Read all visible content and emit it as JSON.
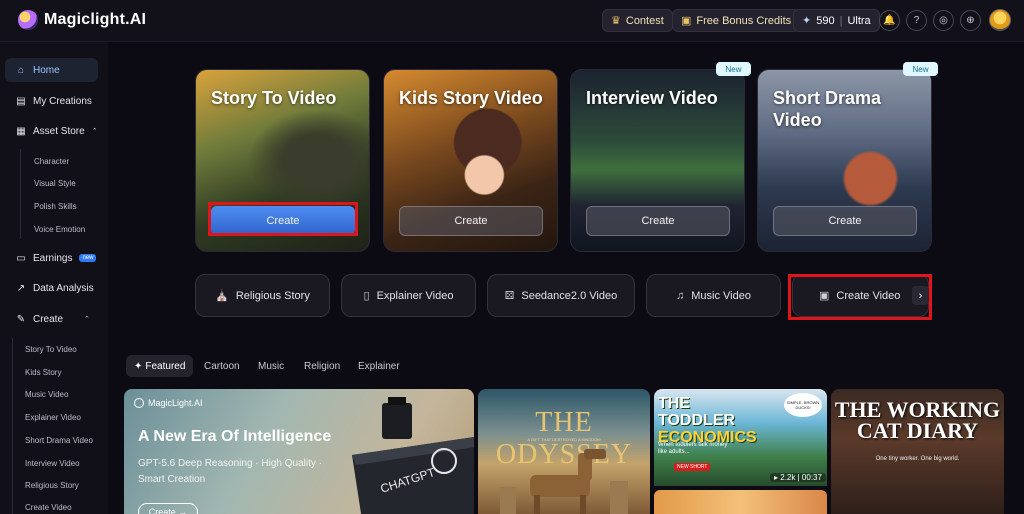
{
  "app": {
    "name": "Magiclight.AI"
  },
  "topbar": {
    "contest": "Contest",
    "bonus": "Free Bonus Credits",
    "credits": "590",
    "plan": "Ultra",
    "separator": "|"
  },
  "sidebar": {
    "home": "Home",
    "my_creations": "My Creations",
    "asset_store": "Asset Store",
    "asset_sub": [
      "Character",
      "Visual Style",
      "Polish Skills",
      "Voice Emotion"
    ],
    "earnings": "Earnings",
    "earnings_badge": "new",
    "data_analysis": "Data Analysis",
    "create": "Create",
    "create_sub": [
      "Story To Video",
      "Kids Story",
      "Music Video",
      "Explainer Video",
      "Short Drama Video",
      "Interview Video",
      "Religious Story",
      "Create Video"
    ]
  },
  "cards": [
    {
      "title": "Story To Video",
      "button": "Create"
    },
    {
      "title": "Kids Story Video",
      "button": "Create"
    },
    {
      "title": "Interview Video",
      "button": "Create",
      "badge": "New"
    },
    {
      "title": "Short Drama Video",
      "button": "Create",
      "badge": "New"
    }
  ],
  "types": [
    "Religious Story",
    "Explainer Video",
    "Seedance2.0 Video",
    "Music Video",
    "Create Video"
  ],
  "categories": [
    "Featured",
    "Cartoon",
    "Music",
    "Religion",
    "Explainer"
  ],
  "featured": {
    "banner": {
      "brand": "MagicLight.AI",
      "title": "A New Era Of Intelligence",
      "subtitle": "GPT-5.6 Deep Reasoning · High Quality · Smart Creation",
      "cta": "Create →",
      "ship_label": "CHATGPT"
    },
    "odyssey": {
      "title": "THE ODYSSEY",
      "subtitle": "A GIFT THAT DESTROYED A KINGDOM"
    },
    "toddler": {
      "title_line1": "TODDLER",
      "title_line2": "ECONOMICS",
      "prefix": "THE",
      "note": "When toddlers talk money like adults...",
      "tag": "NEW SHORT",
      "bubble": "SIMPLE, BROWN DUCKS!",
      "views": "2.2k",
      "duration": "00:37"
    },
    "working_cat": {
      "title": "THE WORKING CAT DIARY",
      "subtitle": "One tiny worker. One big world."
    }
  },
  "colors": {
    "accent": "#2e62c9",
    "highlight": "#e0141b",
    "background": "#0c0b13"
  }
}
